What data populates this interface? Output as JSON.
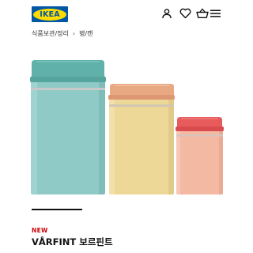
{
  "header": {
    "logo_text": "IKEA",
    "brand_colors": {
      "blue": "#0058a3",
      "yellow": "#ffdb00"
    },
    "icons": [
      "user-icon",
      "heart-icon",
      "basket-icon",
      "menu-icon"
    ]
  },
  "breadcrumb": {
    "items": [
      "식품보관/정리",
      "병/캔"
    ],
    "separator": "›"
  },
  "product_image": {
    "description_icons": [
      "tin-large-teal",
      "tin-medium-yellow",
      "tin-small-pink"
    ],
    "colors": {
      "teal": "#8ec9c6",
      "teal_lid": "#5fb2ab",
      "yellow": "#ecd694",
      "yellow_lid": "#e7a57c",
      "pink": "#f3b7a0",
      "pink_lid": "#e8595a"
    }
  },
  "product": {
    "badge": "NEW",
    "badge_color": "#cc0008",
    "name": "VÅRFINT 보르핀트"
  }
}
